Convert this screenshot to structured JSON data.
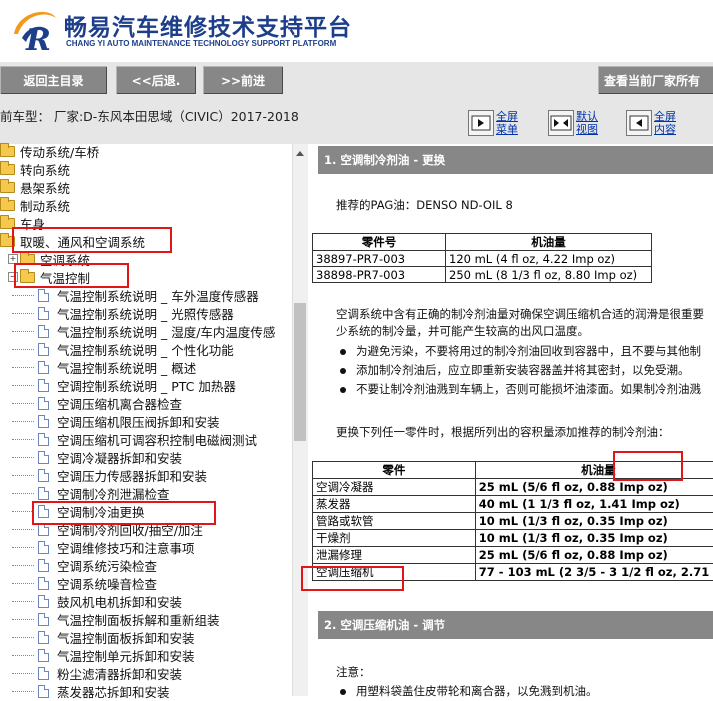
{
  "header": {
    "title": "畅易汽车维修技术支持平台",
    "subtitle": "CHANG YI AUTO MAINTENANCE TECHNOLOGY SUPPORT PLATFORM",
    "logo_letter": "R"
  },
  "nav": {
    "home": "返回主目录",
    "back": "<<后退.",
    "forward": ">>前进",
    "factory": "查看当前厂家所有"
  },
  "info": {
    "car_model": "前车型：  厂家:D-东风本田思域（CIVIC）2017-2018",
    "views": [
      {
        "line1": "全屏",
        "line2": "菜单"
      },
      {
        "line1": "默认",
        "line2": "视图"
      },
      {
        "line1": "全屏",
        "line2": "内容"
      }
    ]
  },
  "tree": {
    "folders": [
      "传动系统/车桥",
      "转向系统",
      "悬架系统",
      "制动系统",
      "车身",
      "取暖、通风和空调系统",
      "空调系统",
      "气温控制"
    ],
    "docs": [
      "气温控制系统说明 _ 车外温度传感器",
      "气温控制系统说明 _ 光照传感器",
      "气温控制系统说明 _ 湿度/车内温度传感",
      "气温控制系统说明 _ 个性化功能",
      "气温控制系统说明 _ 概述",
      "空调控制系统说明 _ PTC 加热器",
      "空调压缩机离合器检查",
      "空调压缩机限压阀拆卸和安装",
      "空调压缩机可调容积控制电磁阀测试",
      "空调冷凝器拆卸和安装",
      "空调压力传感器拆卸和安装",
      "空调制冷剂泄漏检查",
      "空调制冷油更换",
      "空调制冷剂回收/抽空/加注",
      "空调维修技巧和注意事项",
      "空调系统污染检查",
      "空调系统噪音检查",
      "鼓风机电机拆卸和安装",
      "气温控制面板拆解和重新组装",
      "气温控制面板拆卸和安装",
      "气温控制单元拆卸和安装",
      "粉尘滤清器拆卸和安装",
      "蒸发器芯拆卸和安装"
    ]
  },
  "content": {
    "section1": "1. 空调制冷剂油 - 更换",
    "recommended": "推荐的PAG油：DENSO ND-OIL 8",
    "table1": {
      "headers": [
        "零件号",
        "机油量"
      ],
      "rows": [
        [
          "38897-PR7-003",
          "120 mL (4 fl oz, 4.22 Imp oz)"
        ],
        [
          "38898-PR7-003",
          "250 mL (8 1/3 fl oz, 8.80 Imp oz)"
        ]
      ]
    },
    "para1_line1": "空调系统中含有正确的制冷剂油量对确保空调压缩机合适的润滑是很重要",
    "para1_line2": "少系统的制冷量，并可能产生较高的出风口温度。",
    "bullets": [
      "为避免污染，不要将用过的制冷剂油回收到容器中，且不要与其他制",
      "添加制冷剂油后，应立即重新安装容器盖并将其密封，以免受潮。",
      "不要让制冷剂油溅到车辆上，否则可能损坏油漆面。如果制冷剂油溅"
    ],
    "para2": "更换下列任一零件时，根据所列出的容积量添加推荐的制冷剂油：",
    "table2": {
      "headers": [
        "零件",
        "机油量"
      ],
      "rows": [
        [
          "空调冷凝器",
          "25 mL (5/6 fl oz, 0.88 Imp oz)"
        ],
        [
          "蒸发器",
          "40 mL (1 1/3 fl oz, 1.41 Imp oz)"
        ],
        [
          "管路或软管",
          "10 mL (1/3 fl oz, 0.35 Imp oz)"
        ],
        [
          "干燥剂",
          "10 mL (1/3 fl oz, 0.35 Imp oz)"
        ],
        [
          "泄漏修理",
          "25 mL (5/6 fl oz, 0.88 Imp oz)"
        ],
        [
          "空调压缩机",
          "77 - 103 mL (2 3/5 - 3 1/2 fl oz, 2.71 -"
        ]
      ]
    },
    "section2": "2. 空调压缩机油 - 调节",
    "note": "注意：",
    "bullet2": "用塑料袋盖住皮带轮和离合器，以免溅到机油。"
  },
  "colors": {
    "brand_blue": "#1d3f8a",
    "bar_gray": "#878787",
    "highlight_red": "#e0161b"
  }
}
